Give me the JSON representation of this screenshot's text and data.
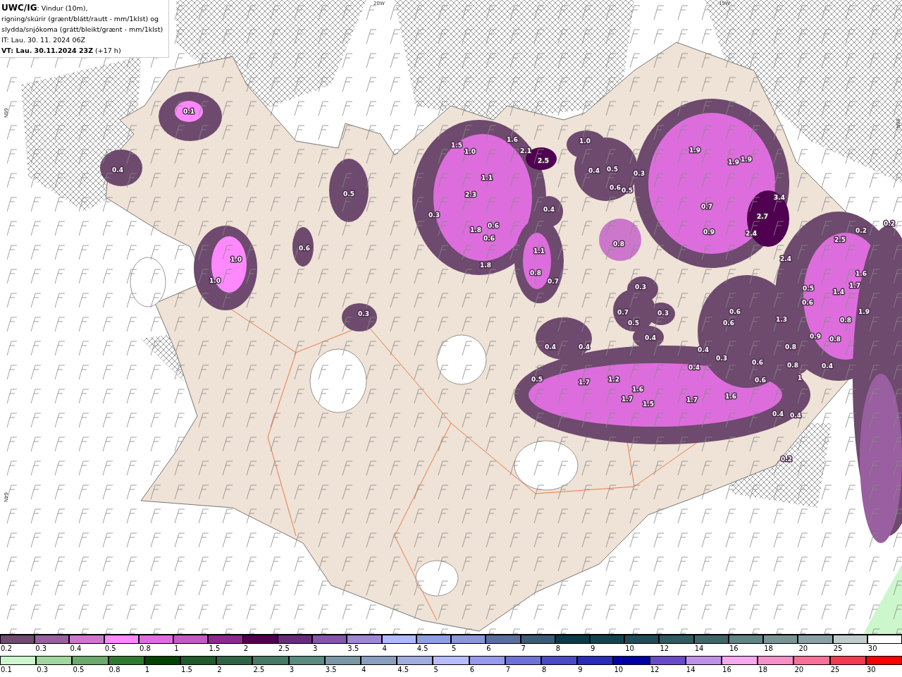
{
  "header": {
    "lines": [
      "**UWC/IG**: Vindur (10m),",
      "rigning/skúrir (grænt/blátt/rautt - mm/1klst) og",
      "slydda/snjókoma (grátt/bleikt/grænt - mm/1klst)",
      "IT: Lau. 30. 11. 2024 06Z",
      "**VT: Lau. 30.11.2024 23Z** (+17 h)"
    ]
  },
  "longitude_labels": [
    "20W",
    "15W"
  ],
  "latitude_labels": [
    "66N",
    "64N",
    "66N"
  ],
  "precipitation_values": [
    "0.1",
    "0.4",
    "0.5",
    "1.0",
    "1.0",
    "0.6",
    "0.3",
    "1.5",
    "1.0",
    "1.6",
    "2.1",
    "2.5",
    "1.1",
    "2.3",
    "0.3",
    "1.8",
    "0.6",
    "0.6",
    "1.8",
    "0.4",
    "1.1",
    "0.8",
    "0.7",
    "1.0",
    "0.4",
    "0.5",
    "0.6",
    "0.5",
    "0.3",
    "1.9",
    "1.9",
    "1.9",
    "0.8",
    "0.7",
    "0.9",
    "3.4",
    "2.7",
    "2.4",
    "2.4",
    "2.5",
    "0.2",
    "0.2",
    "0.3",
    "0.7",
    "0.5",
    "0.3",
    "0.4",
    "0.4",
    "0.4",
    "0.6",
    "0.6",
    "1.3",
    "0.5",
    "0.6",
    "1.4",
    "1.7",
    "1.6",
    "0.8",
    "1.9",
    "0.4",
    "0.3",
    "0.4",
    "0.8",
    "0.9",
    "0.8",
    "0.6",
    "0.8",
    "0.6",
    "1",
    "0.4",
    "0.5",
    "1.7",
    "1.2",
    "1.6",
    "1.7",
    "1.5",
    "1.7",
    "1.6",
    "0.4",
    "0.4",
    "0.2"
  ],
  "legend": {
    "rows": [
      {
        "items": [
          {
            "label": "0.2",
            "color": "#6e4a6e"
          },
          {
            "label": "0.3",
            "color": "#9a5fa0"
          },
          {
            "label": "0.4",
            "color": "#cc77cc"
          },
          {
            "label": "0.5",
            "color": "#ff88ff"
          },
          {
            "label": "0.8",
            "color": "#dd6ddd"
          },
          {
            "label": "1",
            "color": "#c05cc0"
          },
          {
            "label": "1.5",
            "color": "#8a2a8a"
          },
          {
            "label": "2",
            "color": "#500050"
          },
          {
            "label": "2.5",
            "color": "#6a2a7a"
          },
          {
            "label": "3",
            "color": "#8455a8"
          },
          {
            "label": "3.5",
            "color": "#9e88d4"
          },
          {
            "label": "4",
            "color": "#b0b8ff"
          },
          {
            "label": "4.5",
            "color": "#8f9ee0"
          },
          {
            "label": "5",
            "color": "#8a96d6"
          },
          {
            "label": "6",
            "color": "#5a6e9e"
          },
          {
            "label": "7",
            "color": "#3a5a76"
          },
          {
            "label": "8",
            "color": "#0a3a48"
          },
          {
            "label": "9",
            "color": "#124450"
          },
          {
            "label": "10",
            "color": "#1e4c58"
          },
          {
            "label": "12",
            "color": "#2e5a60"
          },
          {
            "label": "14",
            "color": "#3e6666"
          },
          {
            "label": "16",
            "color": "#5e8484"
          },
          {
            "label": "18",
            "color": "#7a9494"
          },
          {
            "label": "20",
            "color": "#8aa0a4"
          },
          {
            "label": "25",
            "color": "#c0cccc"
          },
          {
            "label": "30",
            "color": "#ffffff"
          }
        ]
      },
      {
        "items": [
          {
            "label": "0.1",
            "color": "#ccf7cc"
          },
          {
            "label": "0.3",
            "color": "#a0d8a0"
          },
          {
            "label": "0.5",
            "color": "#6aaa6a"
          },
          {
            "label": "0.8",
            "color": "#2e7a2e"
          },
          {
            "label": "1",
            "color": "#004400"
          },
          {
            "label": "1.5",
            "color": "#1e5a2a"
          },
          {
            "label": "2",
            "color": "#2e6444"
          },
          {
            "label": "2.5",
            "color": "#447a66"
          },
          {
            "label": "3",
            "color": "#5a8a80"
          },
          {
            "label": "3.5",
            "color": "#7a96a4"
          },
          {
            "label": "4",
            "color": "#8a9ec0"
          },
          {
            "label": "4.5",
            "color": "#a0ace0"
          },
          {
            "label": "5",
            "color": "#b8bcff"
          },
          {
            "label": "6",
            "color": "#9898ec"
          },
          {
            "label": "7",
            "color": "#6e72d8"
          },
          {
            "label": "8",
            "color": "#4a4ac4"
          },
          {
            "label": "9",
            "color": "#2a2abc"
          },
          {
            "label": "10",
            "color": "#0000a8"
          },
          {
            "label": "12",
            "color": "#6a4ac8"
          },
          {
            "label": "14",
            "color": "#c090e8"
          },
          {
            "label": "16",
            "color": "#f8a8ec"
          },
          {
            "label": "18",
            "color": "#f890c8"
          },
          {
            "label": "20",
            "color": "#f87098"
          },
          {
            "label": "25",
            "color": "#f83850"
          },
          {
            "label": "30",
            "color": "#ff0000"
          }
        ]
      }
    ]
  }
}
